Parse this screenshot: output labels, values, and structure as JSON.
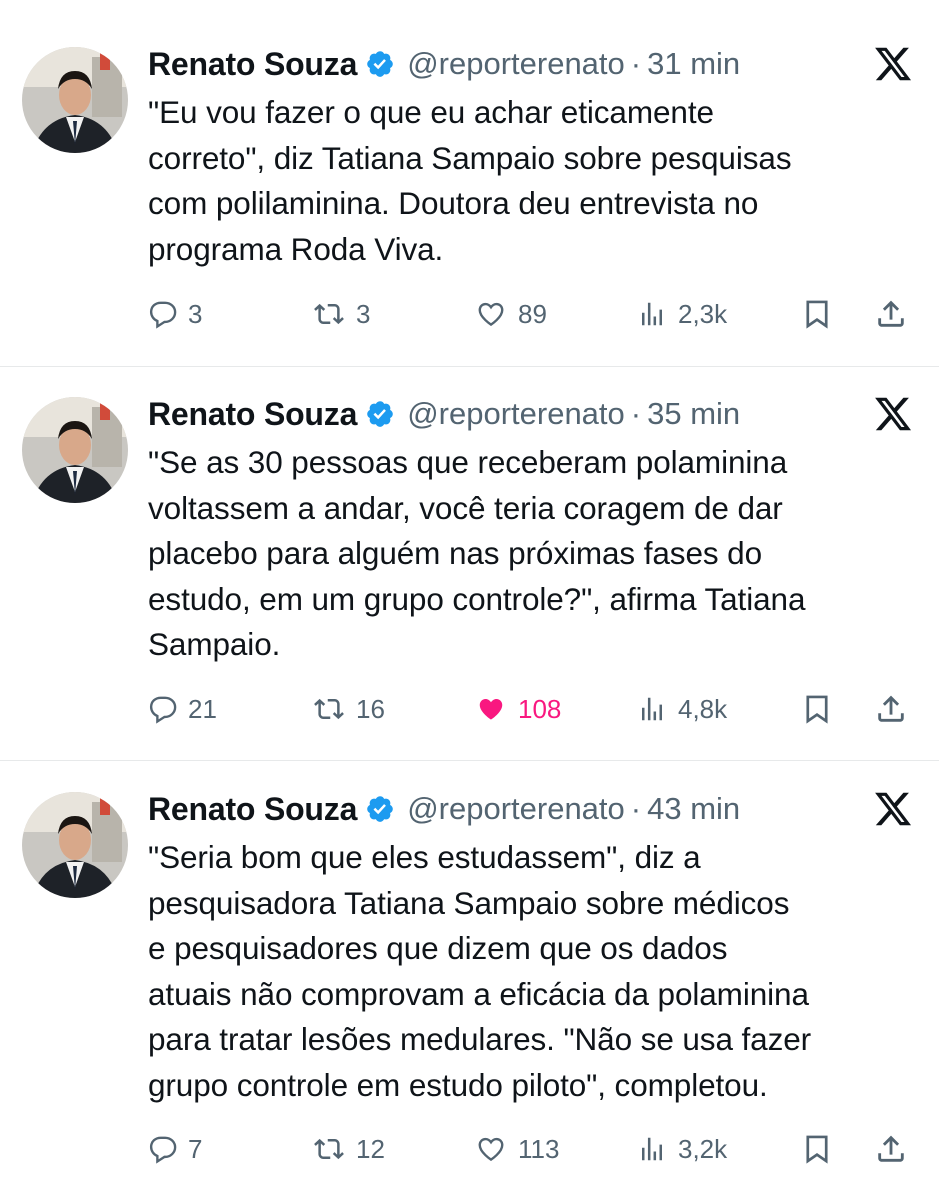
{
  "tweets": [
    {
      "author_name": "Renato Souza",
      "handle": "@reporterenato",
      "separator": "·",
      "time": "31 min",
      "text": "\"Eu vou fazer o que eu achar eticamente\ncorreto\", diz Tatiana Sampaio sobre pesquisas\ncom polilaminina. Doutora deu entrevista no\nprograma Roda Viva.",
      "replies": "3",
      "reposts": "3",
      "likes": "89",
      "views": "2,3k",
      "liked": false
    },
    {
      "author_name": "Renato Souza",
      "handle": "@reporterenato",
      "separator": "·",
      "time": "35 min",
      "text": "\"Se as 30 pessoas que receberam polaminina\nvoltassem a andar, você teria coragem de dar\nplacebo para alguém nas próximas fases do\nestudo, em um grupo controle?\", afirma Tatiana\nSampaio.",
      "replies": "21",
      "reposts": "16",
      "likes": "108",
      "views": "4,8k",
      "liked": true
    },
    {
      "author_name": "Renato Souza",
      "handle": "@reporterenato",
      "separator": "·",
      "time": "43 min",
      "text": "\"Seria bom que eles estudassem\", diz a\npesquisadora Tatiana Sampaio sobre médicos\ne pesquisadores que dizem que os dados\natuais não comprovam a eficácia da polaminina\npara tratar lesões medulares. \"Não se usa fazer\ngrupo controle em estudo piloto\", completou.",
      "replies": "7",
      "reposts": "12",
      "likes": "113",
      "views": "3,2k",
      "liked": false
    }
  ],
  "icons": {
    "verified": "verified-badge-icon",
    "platform": "x-logo-icon",
    "reply": "reply-icon",
    "repost": "repost-icon",
    "like": "heart-icon",
    "views": "views-icon",
    "bookmark": "bookmark-icon",
    "share": "share-icon"
  },
  "colors": {
    "verified": "#1d9bf0",
    "muted": "#536471",
    "liked": "#f91880",
    "divider": "#e7e9ea",
    "text": "#0f1419"
  }
}
